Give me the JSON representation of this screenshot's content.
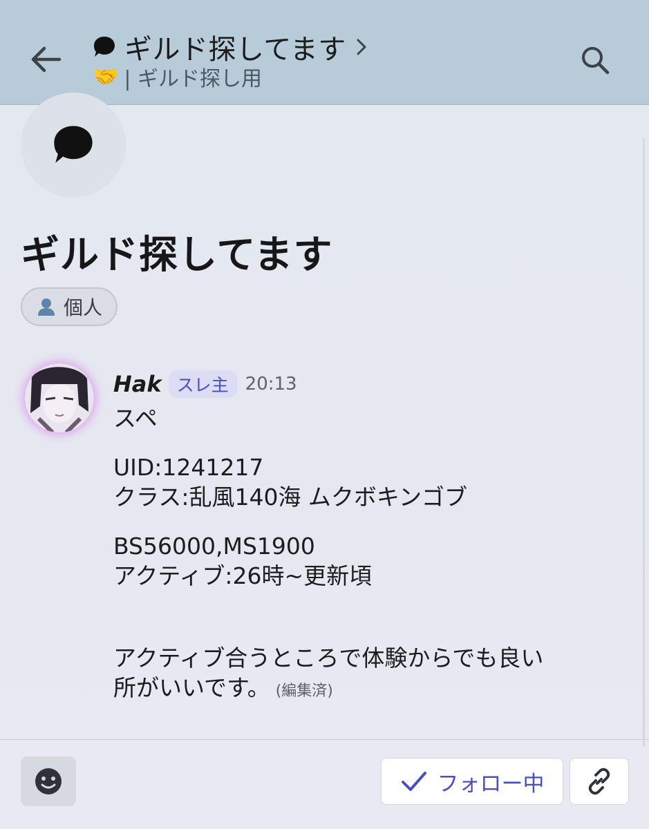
{
  "header": {
    "back_icon": "arrow-left-icon",
    "title_icon": "speech-bubble-icon",
    "title": "ギルド探してます",
    "chevron_icon": "chevron-right-icon",
    "subtitle_emoji": "🤝",
    "subtitle": "| ギルド探し用",
    "search_icon": "search-icon",
    "background": "#b7cbd8"
  },
  "thread": {
    "icon": "speech-bubble-icon",
    "title": "ギルド探してます",
    "tag": {
      "icon": "person-icon",
      "label": "個人"
    }
  },
  "message": {
    "author": "Hak",
    "badge": "スレ主",
    "time": "20:13",
    "lines": [
      "スペ",
      "UID:1241217",
      "クラス:乱風140海 ムクボキンゴブ",
      "BS56000,MS1900",
      "アクティブ:26時~更新頃",
      "アクティブ合うところで体験からでも良い",
      "所がいいです。"
    ],
    "edited": "(編集済)"
  },
  "footer": {
    "emoji_icon": "smiley-icon",
    "follow_label": "フォロー中",
    "follow_icon": "checkmark-icon",
    "link_icon": "link-icon",
    "accent": "#4a4fc0"
  }
}
